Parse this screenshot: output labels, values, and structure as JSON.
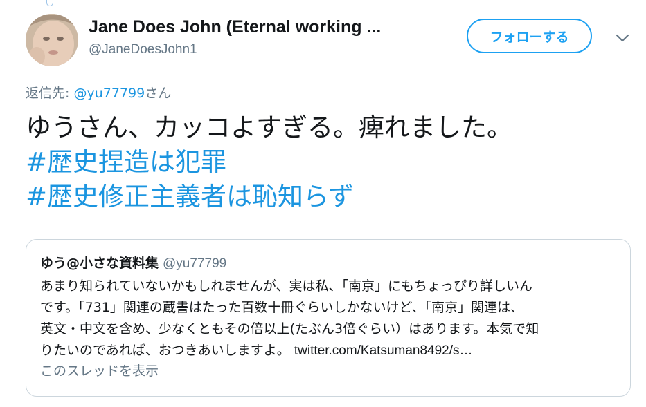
{
  "author": {
    "display_name": "Jane Does John (Eternal working ...",
    "handle": "@JaneDoesJohn1"
  },
  "follow_button": {
    "label": "フォローする"
  },
  "reply": {
    "prefix": "返信先: ",
    "mention": "@yu77799",
    "suffix": "さん"
  },
  "tweet": {
    "line1": "ゆうさん、カッコよすぎる。痺れました。",
    "hashtag1": "#歴史捏造は犯罪",
    "hashtag2": "#歴史修正主義者は恥知らず"
  },
  "quote": {
    "name": "ゆう@小さな資料集",
    "handle": "@yu77799",
    "lines": [
      "あまり知られていないかもしれませんが、実は私、「南京」にもちょっぴり詳しいん",
      "です。「731」関連の蔵書はたった百数十冊ぐらいしかないけど、「南京」関連は、",
      "英文・中文を含め、少なくともその倍以上(たぶん3倍ぐらい）はあります。本気で知",
      "りたいのであれば、おつきあいしますよ。 "
    ],
    "link": "twitter.com/Katsuman8492/s…",
    "thread_label": "このスレッドを表示"
  },
  "icons": {
    "avatar": "profile-photo",
    "caret": "chevron-down-icon"
  },
  "colors": {
    "accent": "#1da1f2",
    "link": "#1b95e0",
    "muted": "#657786",
    "border": "#ccd6dd"
  }
}
